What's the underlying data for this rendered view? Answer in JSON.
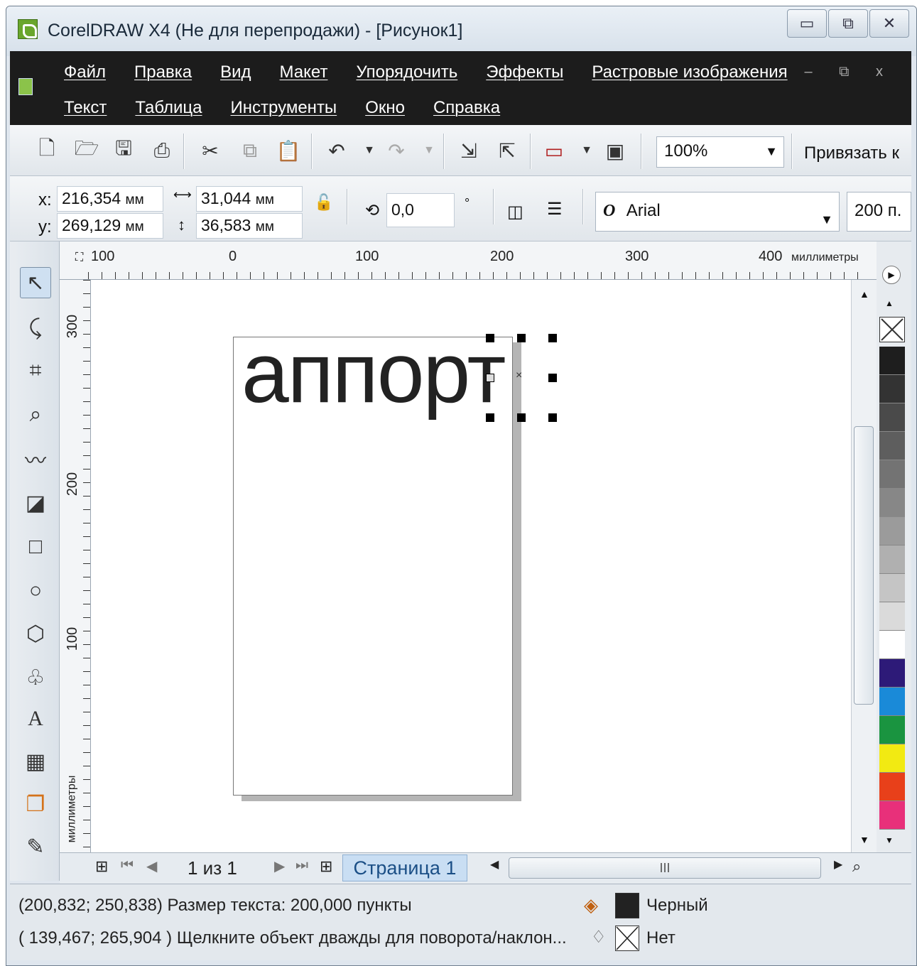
{
  "window": {
    "title": "CorelDRAW X4 (Не для перепродажи) - [Рисунок1]",
    "controls": [
      "▭",
      "⧉",
      "✕"
    ]
  },
  "menu": {
    "row1": [
      "Файл",
      "Правка",
      "Вид",
      "Макет",
      "Упорядочить",
      "Эффекты",
      "Растровые изображения"
    ],
    "row2": [
      "Текст",
      "Таблица",
      "Инструменты",
      "Окно",
      "Справка"
    ],
    "mdi": "– ⧉ x"
  },
  "toolbar": {
    "zoom": "100%",
    "snap": "Привязать к"
  },
  "property_bar": {
    "x_label": "x:",
    "y_label": "y:",
    "x_value": "216,354",
    "y_value": "269,129",
    "w_value": "31,044",
    "h_value": "36,583",
    "unit": "мм",
    "rotation": "0,0",
    "degree": "°",
    "font": "Arial",
    "font_size": "200 п."
  },
  "ruler": {
    "h_labels": [
      "100",
      "0",
      "100",
      "200",
      "300",
      "400"
    ],
    "h_unit": "миллиметры",
    "v_labels": [
      "300",
      "200",
      "100"
    ],
    "v_unit": "миллиметры"
  },
  "canvas": {
    "text": "аппорт"
  },
  "pager": {
    "counter": "1 из 1",
    "tab": "Страница 1",
    "scroll_label": "III"
  },
  "status": {
    "line1": "(200,832; 250,838)  Размер текста: 200,000 пункты",
    "line2": "( 139,467; 265,904 )   Щелкните объект дважды для поворота/наклон...",
    "fill_name": "Черный",
    "outline_name": "Нет",
    "fill_color": "#222222"
  },
  "palette": [
    "#1e1e1e",
    "#333333",
    "#4a4a4a",
    "#5e5e5e",
    "#737373",
    "#878787",
    "#9b9b9b",
    "#b0b0b0",
    "#c5c5c5",
    "#dadada",
    "#ffffff",
    "#2d1a78",
    "#1a8ad8",
    "#1a9440",
    "#f2ea12",
    "#e8401a",
    "#e8307a"
  ]
}
